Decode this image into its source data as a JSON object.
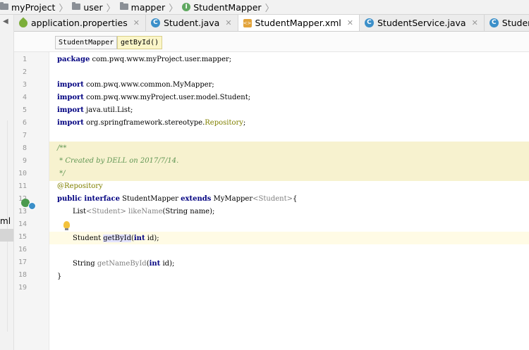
{
  "breadcrumb": [
    "myProject",
    "user",
    "mapper",
    "StudentMapper"
  ],
  "left_strip": {
    "label": "ml"
  },
  "tabs": [
    {
      "label": "application.properties",
      "icon": "properties-file-icon",
      "closable": true
    },
    {
      "label": "Student.java",
      "icon": "class-icon",
      "closable": true
    },
    {
      "label": "StudentMapper.xml",
      "icon": "xml-file-icon",
      "closable": true,
      "active": true
    },
    {
      "label": "StudentService.java",
      "icon": "class-icon",
      "closable": true
    },
    {
      "label": "StudentController.ja",
      "icon": "class-icon",
      "closable": false
    }
  ],
  "editor_crumbs": [
    "StudentMapper",
    "getById()"
  ],
  "line_numbers": [
    "1",
    "2",
    "3",
    "4",
    "5",
    "6",
    "7",
    "8",
    "9",
    "10",
    "11",
    "12",
    "13",
    "14",
    "15",
    "16",
    "17",
    "18",
    "19"
  ],
  "code": {
    "l1_kw": "package",
    "l1_rest": " com.pwq.www.myProject.user.mapper;",
    "import_kw": "import",
    "l3_rest": " com.pwq.www.common.MyMapper;",
    "l4_rest": " com.pwq.www.myProject.user.model.Student;",
    "l5_rest": " java.util.List;",
    "l6_rest": " org.springframework.stereotype.",
    "l6_ann": "Repository",
    "l6_end": ";",
    "l8": "/**",
    "l9": " * Created by DELL on 2017/7/14.",
    "l10": " */",
    "l11": "@Repository",
    "l12_kw1": "public interface",
    "l12_name": " StudentMapper ",
    "l12_kw2": "extends",
    "l12_rest": " MyMapper",
    "l12_gen": "<Student>",
    "l12_end": "{",
    "l13_a": "List",
    "l13_gen": "<Student>",
    "l13_method": " likeName",
    "l13_rest": "(String name);",
    "l15_a": "Student ",
    "l15_method": "getById",
    "l15_b": "(",
    "l15_kw": "int",
    "l15_c": " id);",
    "l17_a": "String ",
    "l17_method": "getNameById",
    "l17_b": "(",
    "l17_kw": "int",
    "l17_c": " id);",
    "l18": "}"
  },
  "colors": {
    "keyword": "#000080",
    "doc_comment": "#629755",
    "annotation": "#808000",
    "comment_bg": "#f7f2cf",
    "caret_line": "#fffbe5"
  }
}
